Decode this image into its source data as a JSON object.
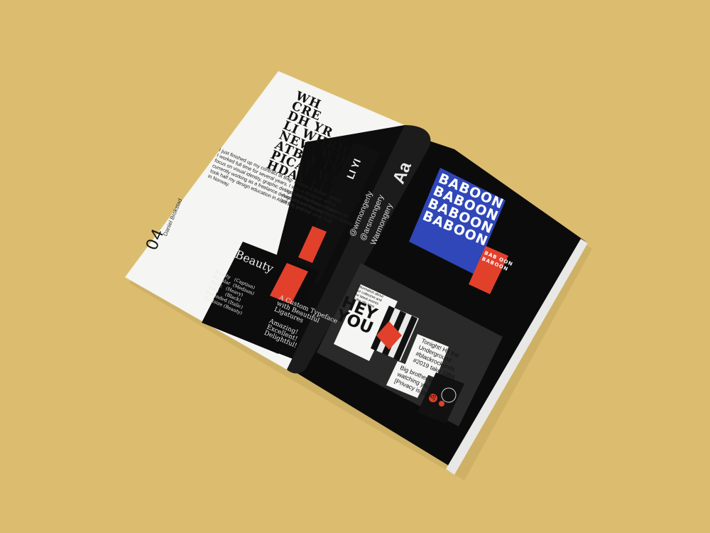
{
  "left_page": {
    "page_number": "04",
    "author": "Daniel Brokstad",
    "headline": "WH\nCRE\nDH YR\nLI WHRH\nNEW: WH\nATB A TY\nPICAL WBE\nHDAY LEIKE?",
    "body_text": "I just finished up my contract at Bag-\nmotion & Balder, where I worked full time\nfor several years. I was a designer with a\nfocus on visual identity, graphic design\nand illustration. I am currently working\nas a freelance designer from Norway.\nI took half my design education in\nAustralia and the other half in Norway.",
    "body_text_2": "I took half my design\neducation in Australia\nand the other half in\nNorway the last two years of",
    "beauty_title": "Beauty",
    "beauty_lines": "Beauty   (Caption)\nRegular  (Medium)\nItalic   (Heavy)\nBold     (Black)\nExtended (Italic)\nFontsize (Beauty)",
    "beauty_side": "A Custom Typeface\nwith Beautiful\nLigatures\n\nAmazing!\nExcellent!\nDelightful!",
    "handles": [
      "@wrmongerly",
      "@arsmongery",
      "Warmongery"
    ],
    "aa": "Aa",
    "side_heading": "LI\nYI"
  },
  "right_page": {
    "baboon_poster": "BABOON\nBABOON\nBABOON\nBABOON",
    "baboon_card": "BAB OON\nBABOON",
    "hey_you": "HEY\nYOU",
    "mini_heading": "Information about\nour collective and\nthe latest events\nin the city area",
    "sticker_1": "Tonight! Hit the\nUnderground\n#blackrockunds\n#2019 take 1984",
    "sticker_2": "Big brother is\nwatching you\n[Privacy is dead]"
  },
  "colors": {
    "background": "#dcbd6f",
    "page_black": "#0b0b0b",
    "accent_red": "#e1402b",
    "accent_blue": "#2f47b8",
    "paper_white": "#f5f5f3"
  }
}
